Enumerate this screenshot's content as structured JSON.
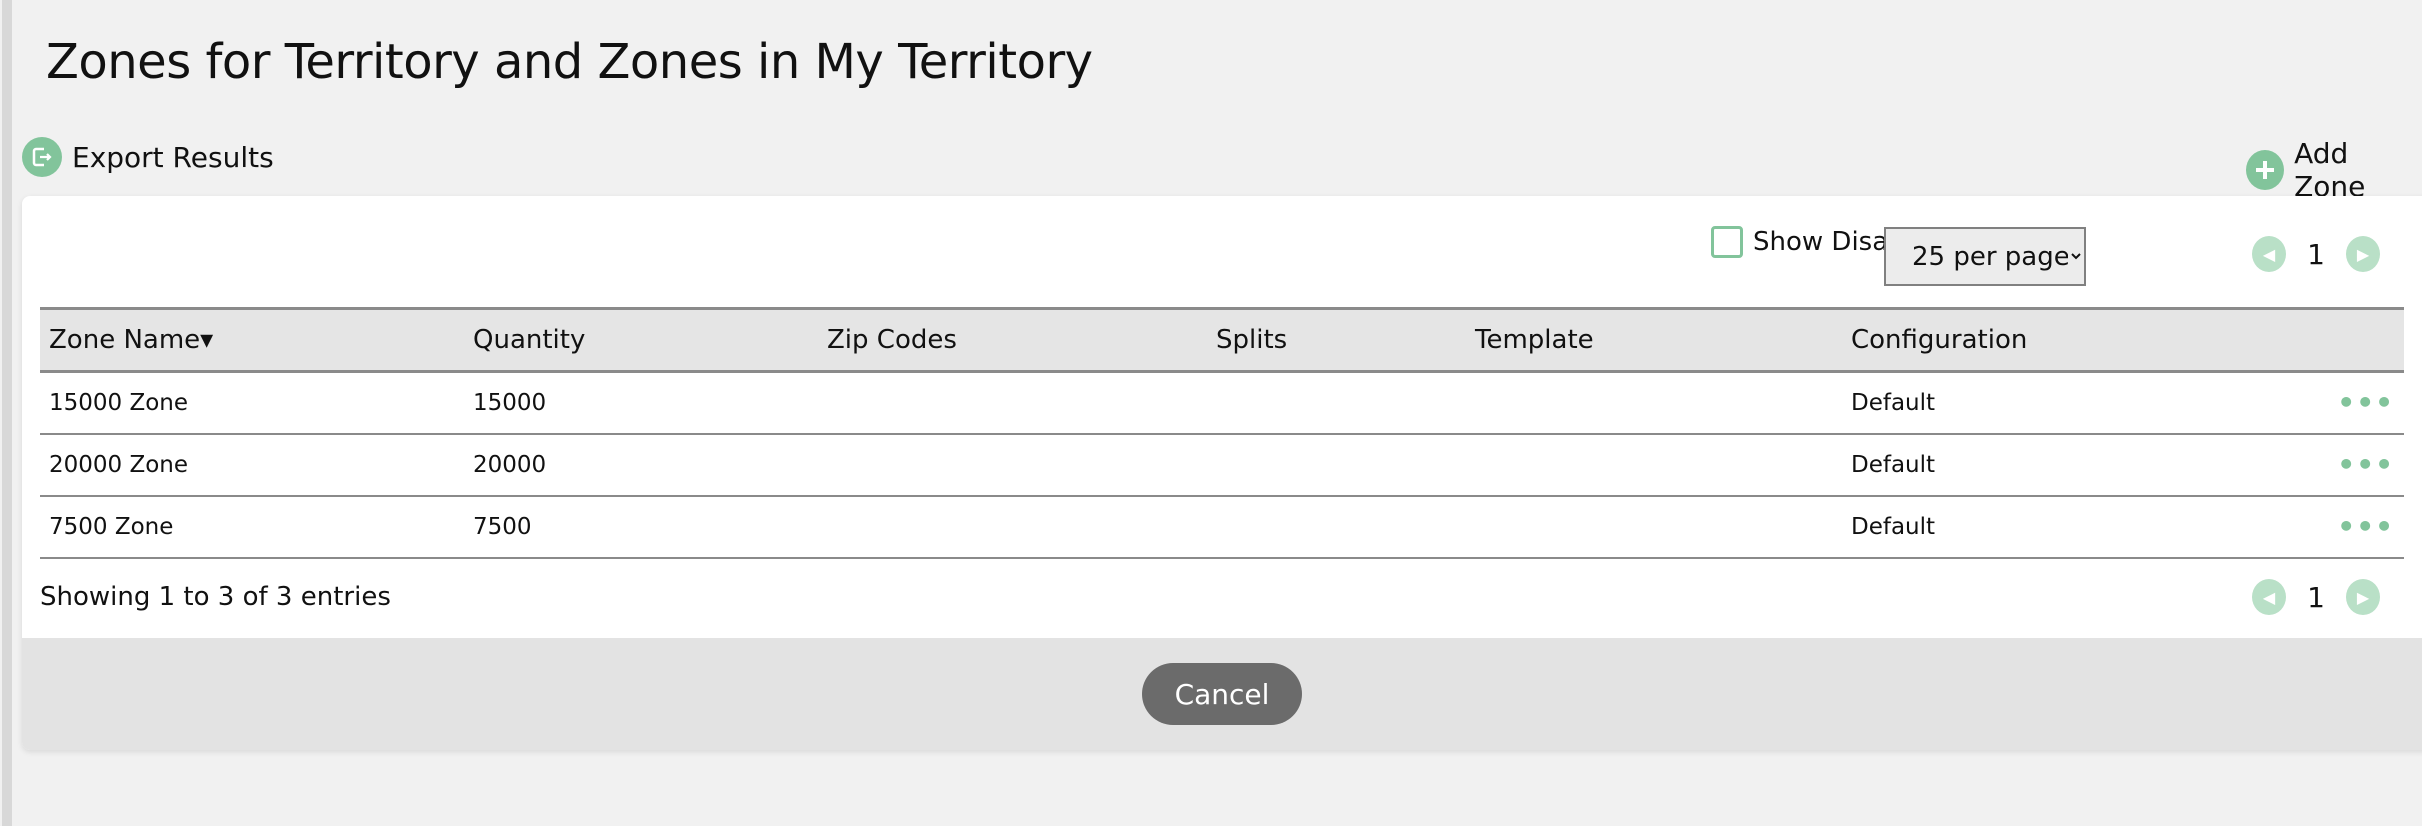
{
  "title": "Zones for Territory and Zones in My Territory",
  "actions": {
    "export": "Export Results",
    "add": "Add Zone"
  },
  "controls": {
    "show_disabled": "Show Disabled",
    "show_disabled_checked": false,
    "per_page": "25 per page",
    "page": "1"
  },
  "table": {
    "columns": [
      "Zone Name",
      "Quantity",
      "Zip Codes",
      "Splits",
      "Template",
      "Configuration"
    ],
    "sort_indicator": "▾",
    "rows": [
      [
        "15000 Zone",
        "15000",
        "",
        "",
        "",
        "Default"
      ],
      [
        "20000 Zone",
        "20000",
        "",
        "",
        "",
        "Default"
      ],
      [
        "7500 Zone",
        "7500",
        "",
        "",
        "",
        "Default"
      ]
    ],
    "row_menu": "•••"
  },
  "footer": {
    "showing": "Showing 1 to 3 of 3 entries",
    "page": "1",
    "cancel": "Cancel"
  },
  "colors": {
    "accent": "#82c49b",
    "accent_light": "#b9e0c7",
    "cancel_bg": "#6b6b6b"
  }
}
